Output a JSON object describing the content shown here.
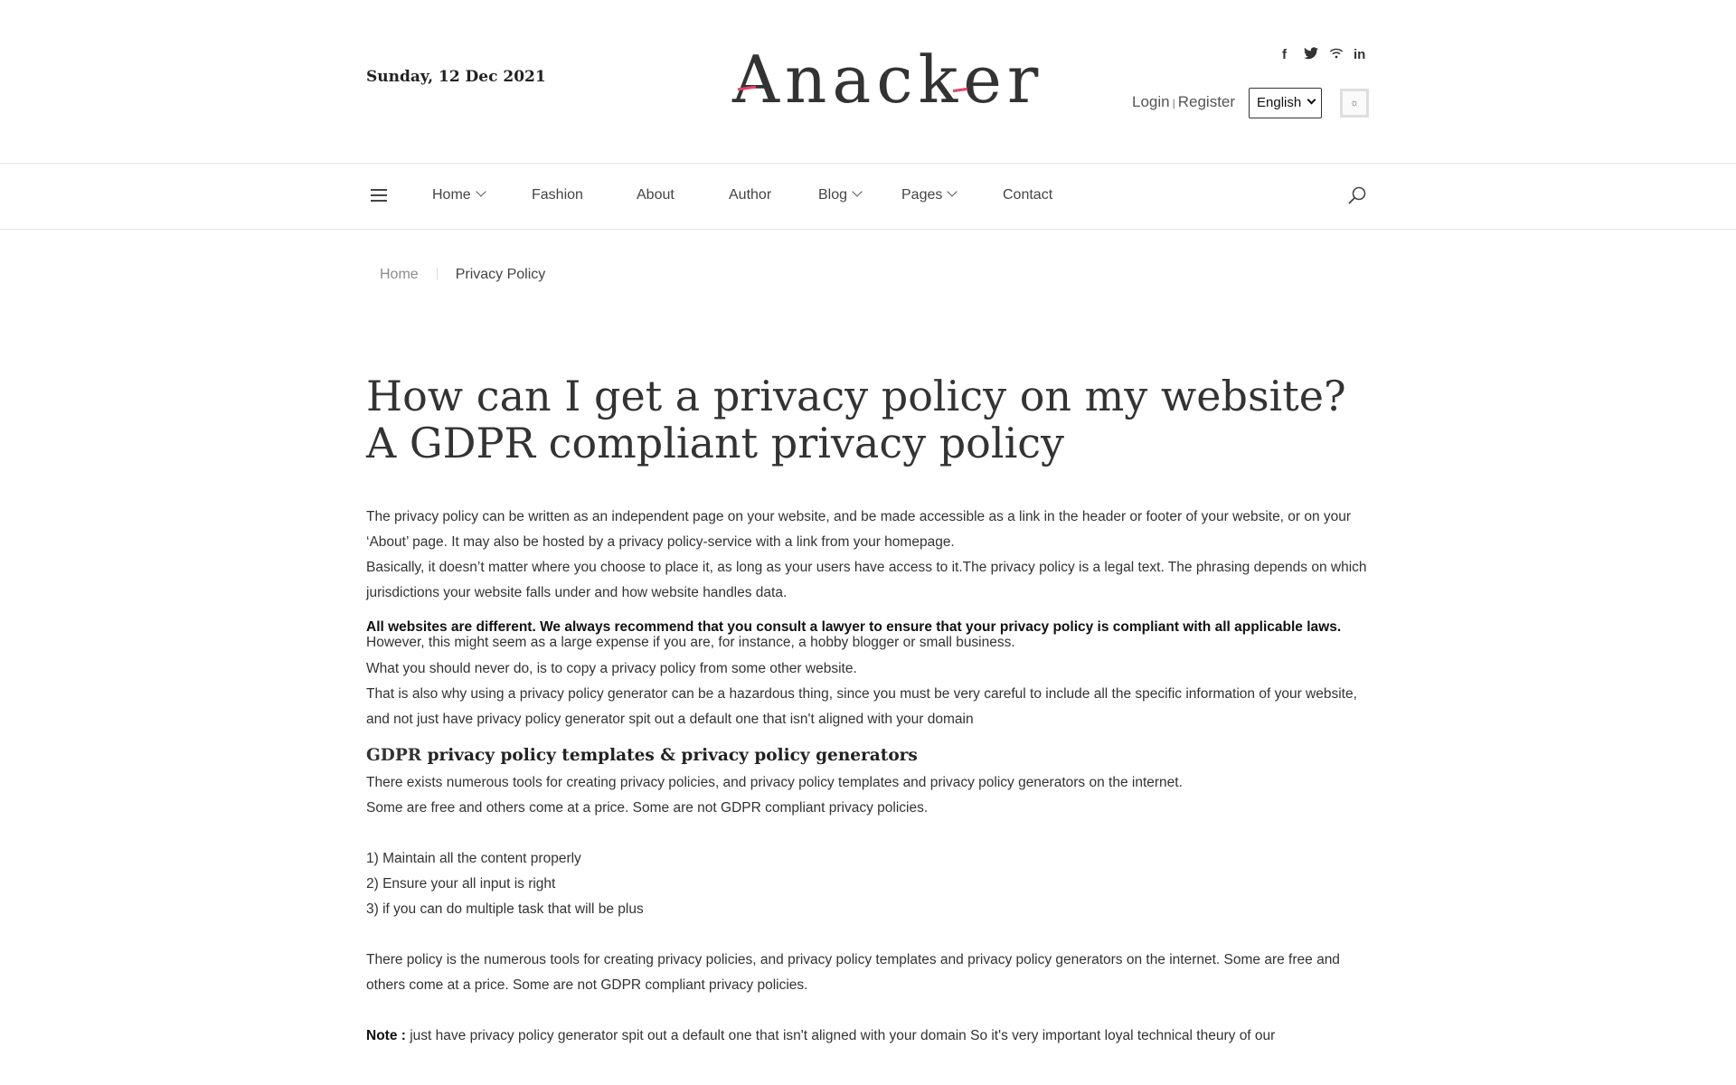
{
  "header": {
    "date": "Sunday, 12 Dec 2021",
    "logo_text": "Anacker",
    "social": [
      {
        "icon": "facebook-icon",
        "glyph": "f"
      },
      {
        "icon": "twitter-icon",
        "glyph": "🐦"
      },
      {
        "icon": "rss-wifi-icon",
        "glyph": "≋"
      },
      {
        "icon": "linkedin-icon",
        "glyph": "in"
      }
    ],
    "login_label": "Login",
    "auth_separator": "|",
    "register_label": "Register",
    "language_selected": "English",
    "theme_toggle_glyph": "☼",
    "accent_color": "#e8416a"
  },
  "nav": {
    "items": [
      {
        "label": "Home",
        "dropdown": true
      },
      {
        "label": "Fashion",
        "dropdown": false
      },
      {
        "label": "About",
        "dropdown": false
      },
      {
        "label": "Author",
        "dropdown": false
      },
      {
        "label": "Blog",
        "dropdown": true
      },
      {
        "label": "Pages",
        "dropdown": true
      },
      {
        "label": "Contact",
        "dropdown": false
      }
    ]
  },
  "breadcrumb": {
    "home": "Home",
    "current": "Privacy Policy"
  },
  "article": {
    "title": "How can I get a privacy policy on my website? A GDPR compliant privacy policy",
    "p1": "The privacy policy can be written as an independent page on your website, and be made accessible as a link in the header or footer of your website, or on your ‘About’ page. It may also be hosted by a privacy policy-service with a link from your homepage.",
    "p2": "Basically, it doesn’t matter where you choose to place it, as long as your users have access to it.The privacy policy is a legal text. The phrasing depends on which jurisdictions your website falls under and how  website handles data.",
    "bold_lead": "All websites are different. We always recommend that you consult a lawyer to ensure that your privacy policy is compliant with all applicable laws.",
    "bold_rest": " However, this might seem as a large expense if you are, for instance, a hobby blogger or small business.",
    "p3": "What you should never do, is to copy a privacy policy from some other website.",
    "p4": "That is also why using a privacy policy generator can be a hazardous thing, since you must be very careful to include all the specific information of your website, and not just have privacy policy generator spit out a default one that isn't aligned with your domain",
    "subheading_prefix": "GDPR",
    "subheading_bold": "privacy policy templates & privacy policy generators",
    "p5": "There exists numerous tools for creating privacy policies, and privacy policy templates and privacy policy generators on the internet.",
    "p6": "Some are free and others come at a price. Some are not GDPR compliant privacy policies.",
    "list": [
      "1) Maintain all the content properly",
      "2) Ensure your all input is right",
      "3) if you can do multiple task that will be plus"
    ],
    "p7": "There policy is the numerous tools for creating privacy policies, and privacy policy templates and privacy policy generators on the internet. Some are free and others come at a price. Some are not GDPR compliant privacy policies.",
    "note_label": "Note :",
    "note_text": " just have privacy policy generator spit out a default one that isn't aligned with your domain So it's very important loyal technical theury of our"
  }
}
